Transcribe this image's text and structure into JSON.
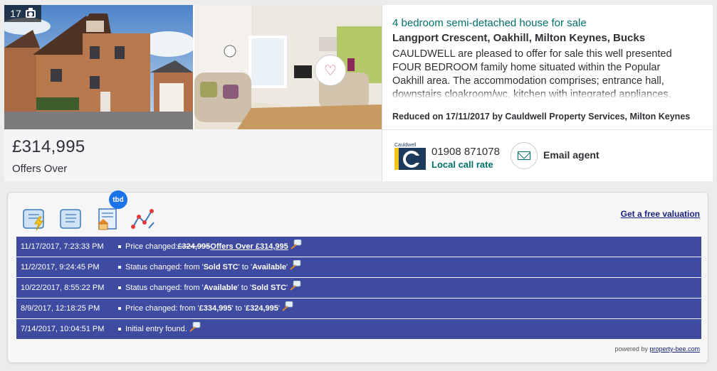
{
  "listing": {
    "photo_count": "17",
    "price": "£314,995",
    "price_qualifier": "Offers Over",
    "title": "4 bedroom semi-detached house for sale",
    "address": "Langport Crescent, Oakhill, Milton Keynes, Bucks",
    "summary": "CAULDWELL are pleased to offer for sale this well presented FOUR BEDROOM family home situated within the Popular Oakhill area. The accommodation comprises; entrance hall, downstairs cloakroom/wc, kitchen with integrated appliances,",
    "reduced_note": "Reduced on 17/11/2017 by Cauldwell Property Services, Milton Keynes",
    "icons": {
      "camera": "camera-icon",
      "favourite": "heart-icon",
      "email": "envelope-icon"
    }
  },
  "agent": {
    "logo_text": "Cauldwell",
    "phone": "01908 871078",
    "rate_label": "Local call rate",
    "email_label": "Email agent"
  },
  "history": {
    "badge": "tbd",
    "valuation_link": "Get a free valuation",
    "powered_by": "powered by",
    "powered_link": "property-bee.com",
    "rows": [
      {
        "time": "11/17/2017, 7:23:33 PM",
        "prefix": "Price changed: ",
        "old": "£324,995",
        "new": " Offers Over £314,995"
      },
      {
        "time": "11/2/2017, 9:24:45 PM",
        "prefix": "Status changed: from '",
        "from": "Sold STC",
        "mid": "' to '",
        "to": "Available",
        "suffix": "'"
      },
      {
        "time": "10/22/2017, 8:55:22 PM",
        "prefix": "Status changed: from '",
        "from": "Available",
        "mid": "' to '",
        "to": "Sold STC",
        "suffix": "'"
      },
      {
        "time": "8/9/2017, 12:18:25 PM",
        "prefix": "Price changed: from '",
        "from": "£334,995",
        "mid": "' to '",
        "to": "£324,995",
        "suffix": "'"
      },
      {
        "time": "7/14/2017, 10:04:51 PM",
        "prefix": "Initial entry found.",
        "from": "",
        "mid": "",
        "to": "",
        "suffix": ""
      }
    ]
  },
  "colors": {
    "accent": "#00706b",
    "history_row": "#3f4ba0",
    "badge": "#1a73e8"
  }
}
